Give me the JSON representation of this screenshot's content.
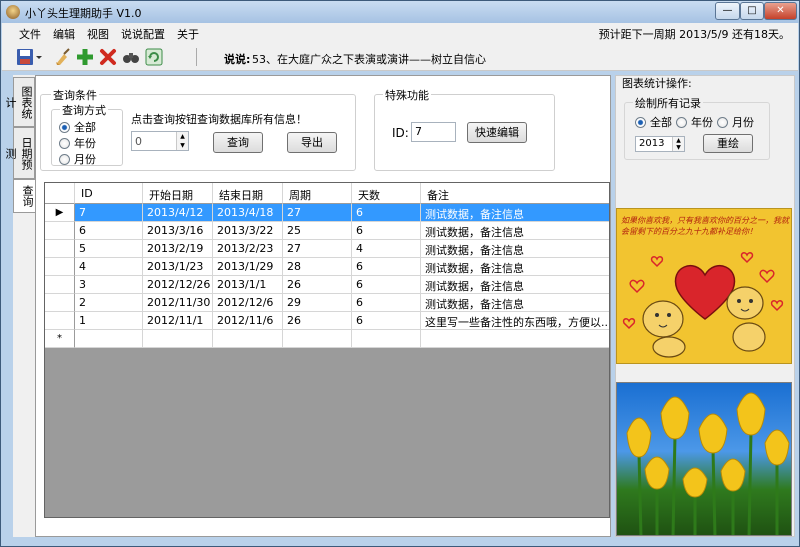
{
  "window": {
    "title": "小丫头生理期助手 V1.0",
    "min_label": "—",
    "max_label": "□",
    "close_label": "✕"
  },
  "menu": {
    "items": [
      "文件",
      "编辑",
      "视图",
      "说说配置",
      "关于"
    ],
    "countdown": "预计距下一周期 2013/5/9 还有18天。"
  },
  "toolbar": {
    "icons": [
      "save-icon",
      "dropdown-icon",
      "broom-icon",
      "add-icon",
      "delete-icon",
      "binoculars-icon",
      "refresh-icon"
    ],
    "motto_label": "说说:",
    "motto_text": "53、在大庭广众之下表演或演讲——树立自信心"
  },
  "tabs": [
    "图表统计",
    "日期预测",
    "查询"
  ],
  "query": {
    "group_title": "查询条件",
    "mode_title": "查询方式",
    "modes": [
      "全部",
      "年份",
      "月份"
    ],
    "selected_mode": "全部",
    "hint": "点击查询按钮查询数据库所有信息！",
    "spin_value": "0",
    "query_button": "查询",
    "export_button": "导出"
  },
  "special": {
    "group_title": "特殊功能",
    "id_label": "ID:",
    "id_value": "7",
    "edit_button": "快速编辑"
  },
  "table": {
    "columns": [
      "ID",
      "开始日期",
      "结束日期",
      "周期",
      "天数",
      "备注"
    ],
    "rows": [
      [
        "7",
        "2013/4/12",
        "2013/4/18",
        "27",
        "6",
        "测试数据，备注信息"
      ],
      [
        "6",
        "2013/3/16",
        "2013/3/22",
        "25",
        "6",
        "测试数据，备注信息"
      ],
      [
        "5",
        "2013/2/19",
        "2013/2/23",
        "27",
        "4",
        "测试数据，备注信息"
      ],
      [
        "4",
        "2013/1/23",
        "2013/1/29",
        "28",
        "6",
        "测试数据，备注信息"
      ],
      [
        "3",
        "2012/12/26",
        "2013/1/1",
        "26",
        "6",
        "测试数据，备注信息"
      ],
      [
        "2",
        "2012/11/30",
        "2012/12/6",
        "29",
        "6",
        "测试数据，备注信息"
      ],
      [
        "1",
        "2012/11/1",
        "2012/11/6",
        "26",
        "6",
        "这里写一些备注性的东西哦，方便以..."
      ]
    ],
    "selected_row": 0,
    "new_row_marker": "*",
    "current_marker": "▶"
  },
  "chart_ops": {
    "title": "图表统计操作:",
    "group_title": "绘制所有记录",
    "modes": [
      "全部",
      "年份",
      "月份"
    ],
    "selected_mode": "全部",
    "year_value": "2013",
    "redraw_button": "重绘"
  },
  "poster": {
    "text": "如果你喜欢我，只有我喜欢你的百分之一，我就会留剩下的百分之九十九都补足给你！"
  },
  "colors": {
    "selection": "#3399ff",
    "poster_bg": "#f2c430",
    "heart": "#d9252b",
    "sky": "#1a6fd2",
    "tulip": "#f3c41b"
  }
}
